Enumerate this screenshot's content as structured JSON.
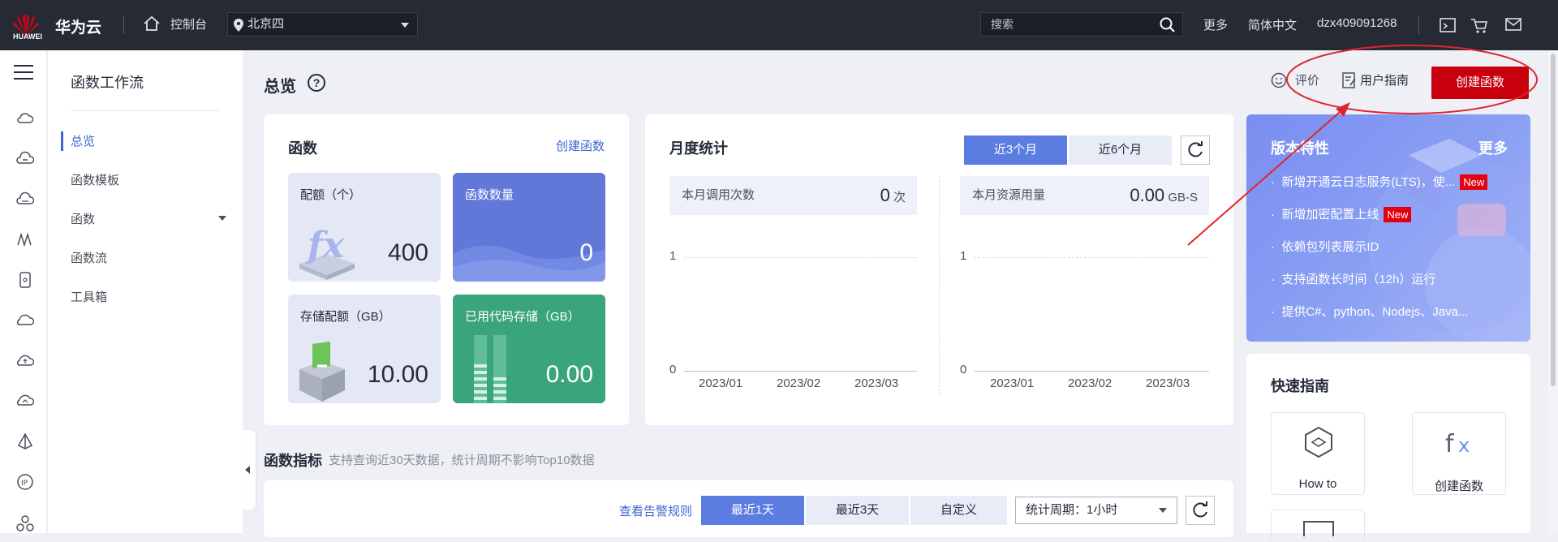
{
  "topbar": {
    "logo_text": "HUAWEI",
    "brand": "华为云",
    "console": "控制台",
    "region": "北京四",
    "search_placeholder": "搜索",
    "more": "更多",
    "language": "简体中文",
    "username": "dzx409091268"
  },
  "sidenav": {
    "title": "函数工作流",
    "items": [
      "总览",
      "函数模板",
      "函数",
      "函数流",
      "工具箱"
    ]
  },
  "page": {
    "title": "总览",
    "rate": "评价",
    "user_guide": "用户指南",
    "create_function": "创建函数"
  },
  "functions_card": {
    "title": "函数",
    "create_link": "创建函数",
    "tiles": [
      {
        "label": "配额（个）",
        "value": "400"
      },
      {
        "label": "函数数量",
        "value": "0"
      },
      {
        "label": "存储配额（GB）",
        "value": "10.00"
      },
      {
        "label": "已用代码存储（GB）",
        "value": "0.00"
      }
    ]
  },
  "monthly": {
    "title": "月度统计",
    "tabs": [
      "近3个月",
      "近6个月"
    ],
    "calls_label": "本月调用次数",
    "calls_value": "0",
    "calls_unit": "次",
    "resource_label": "本月资源用量",
    "resource_value": "0.00",
    "resource_unit": "GB-S",
    "y_ticks": [
      "1",
      "0"
    ],
    "x_ticks": [
      "2023/01",
      "2023/02",
      "2023/03"
    ]
  },
  "features": {
    "title": "版本特性",
    "more": "更多",
    "items": [
      "新增开通云日志服务(LTS)，使...",
      "新增加密配置上线",
      "依赖包列表展示ID",
      "支持函数长时间（12h）运行",
      "提供C#、python、Nodejs、Java..."
    ],
    "new_badge": "New"
  },
  "quick_guide": {
    "title": "快速指南",
    "items": [
      "How to",
      "创建函数"
    ]
  },
  "metrics": {
    "title": "函数指标",
    "subtitle": "支持查询近30天数据，统计周期不影响Top10数据",
    "alarm_link": "查看告警规则",
    "ranges": [
      "最近1天",
      "最近3天",
      "自定义"
    ],
    "period": "统计周期：1小时"
  },
  "colors": {
    "accent": "#5b7ce0",
    "brand_red": "#c7000b",
    "link": "#3d66d1",
    "tile_blue": "#6178d9",
    "tile_green": "#3aa57a",
    "annotation": "#e0242b"
  }
}
